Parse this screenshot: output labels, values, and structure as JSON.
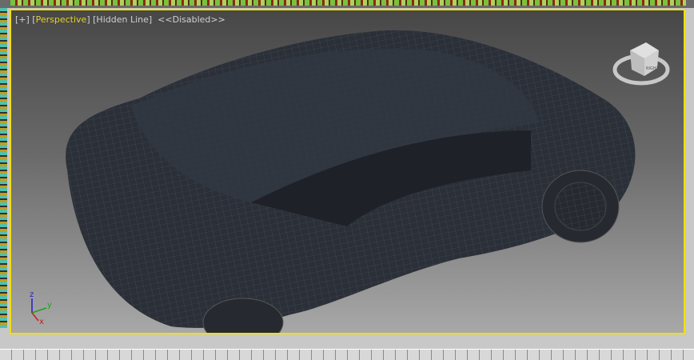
{
  "viewport": {
    "menu_label": "[+]",
    "view_label": "Perspective",
    "shading_label": "Hidden Line",
    "status_label": "<<Disabled>>",
    "active_border_color": "#f0e000"
  },
  "viewcube": {
    "face_label": "RIGHT"
  },
  "axis_tripod": {
    "x": "x",
    "y": "y",
    "z": "z"
  }
}
